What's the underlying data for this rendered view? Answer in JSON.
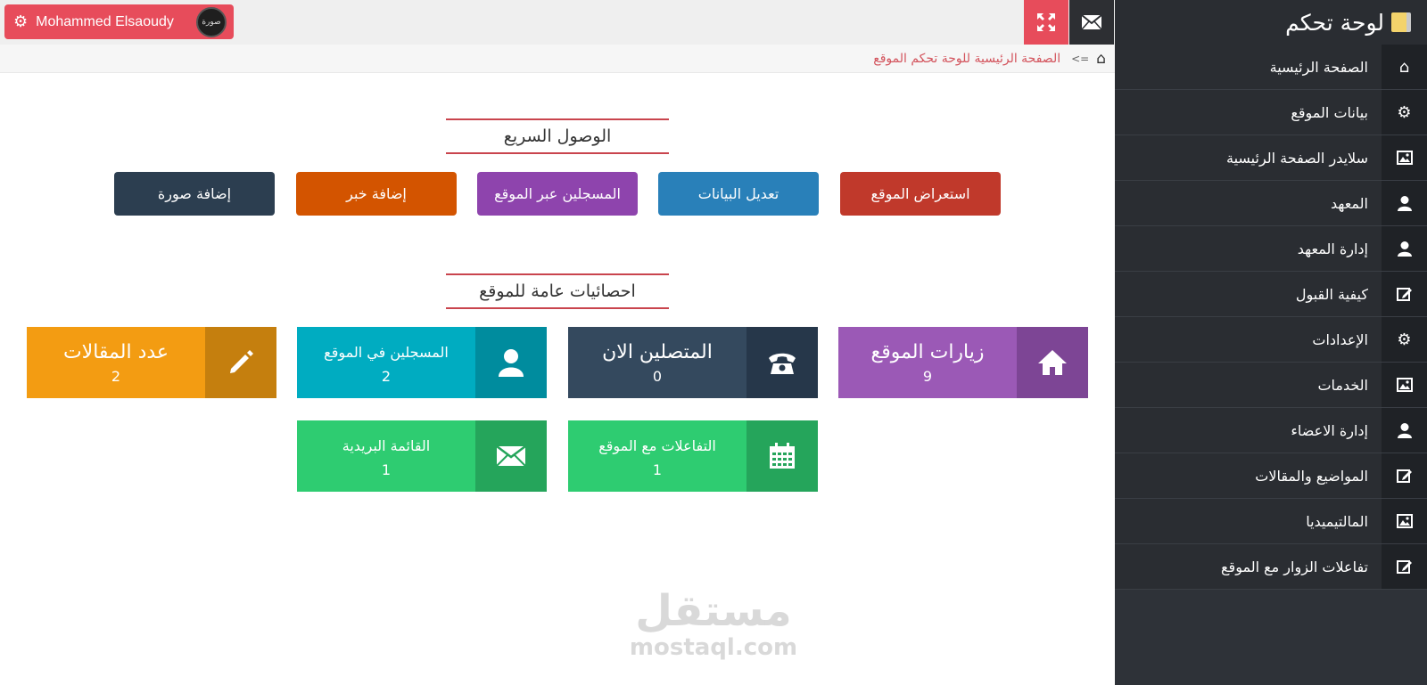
{
  "topbar": {
    "user_name": "Mohammed Elsaoudy",
    "avatar_text": "صورة",
    "icons": {
      "settings": "gear-icon",
      "fullscreen": "expand-icon",
      "messages": "envelope-icon",
      "menu": "hamburger-icon"
    }
  },
  "breadcrumb": {
    "separator": "=>",
    "current": "الصفحة الرئيسية للوحة تحكم الموقع"
  },
  "sidebar": {
    "brand": "لوحة تحكم",
    "items": [
      {
        "label": "الصفحة الرئيسية",
        "icon": "home-icon"
      },
      {
        "label": "بيانات الموقع",
        "icon": "gear-icon"
      },
      {
        "label": "سلايدر الصفحة الرئيسية",
        "icon": "image-icon"
      },
      {
        "label": "المعهد",
        "icon": "user-icon"
      },
      {
        "label": "إدارة المعهد",
        "icon": "user-icon"
      },
      {
        "label": "كيفية القبول",
        "icon": "edit-icon"
      },
      {
        "label": "الإعدادات",
        "icon": "gear-icon"
      },
      {
        "label": "الخدمات",
        "icon": "image-icon"
      },
      {
        "label": "إدارة الاعضاء",
        "icon": "user-icon"
      },
      {
        "label": "المواضيع والمقالات",
        "icon": "edit-icon"
      },
      {
        "label": "المالتيميديا",
        "icon": "image-icon"
      },
      {
        "label": "تفاعلات الزوار مع الموقع",
        "icon": "edit-icon"
      }
    ]
  },
  "quick_access": {
    "title": "الوصول السريع",
    "buttons": [
      {
        "label": "استعراض الموقع",
        "color": "#c0392b"
      },
      {
        "label": "تعديل البيانات",
        "color": "#2980b9"
      },
      {
        "label": "المسجلين عبر الموقع",
        "color": "#8e44ad"
      },
      {
        "label": "إضافة خبر",
        "color": "#d35400"
      },
      {
        "label": "إضافة صورة",
        "color": "#2c3e50"
      }
    ]
  },
  "stats": {
    "title": "احصائيات عامة للموقع",
    "cards": [
      {
        "title": "زيارات الموقع",
        "value": "9",
        "icon": "home-icon",
        "color": "#9b59b6",
        "icon_color": "#7d4595"
      },
      {
        "title": "المتصلين الان",
        "value": "0",
        "icon": "phone-icon",
        "color": "#34495e",
        "icon_color": "#26374a"
      },
      {
        "title": "المسجلين في الموقع",
        "value": "2",
        "icon": "user-icon",
        "color": "#00acc1",
        "icon_color": "#008c9e"
      },
      {
        "title": "عدد المقالات",
        "value": "2",
        "icon": "pencil-icon",
        "color": "#f39c12",
        "icon_color": "#c57f0e"
      },
      {
        "title": "التفاعلات مع الموقع",
        "value": "1",
        "icon": "calendar-icon",
        "color": "#2ecc71",
        "icon_color": "#25a55b"
      },
      {
        "title": "القائمة البريدية",
        "value": "1",
        "icon": "envelope-icon",
        "color": "#2ecc71",
        "icon_color": "#25a55b"
      }
    ]
  },
  "watermark": {
    "arabic": "مستقل",
    "latin": "mostaql.com"
  }
}
